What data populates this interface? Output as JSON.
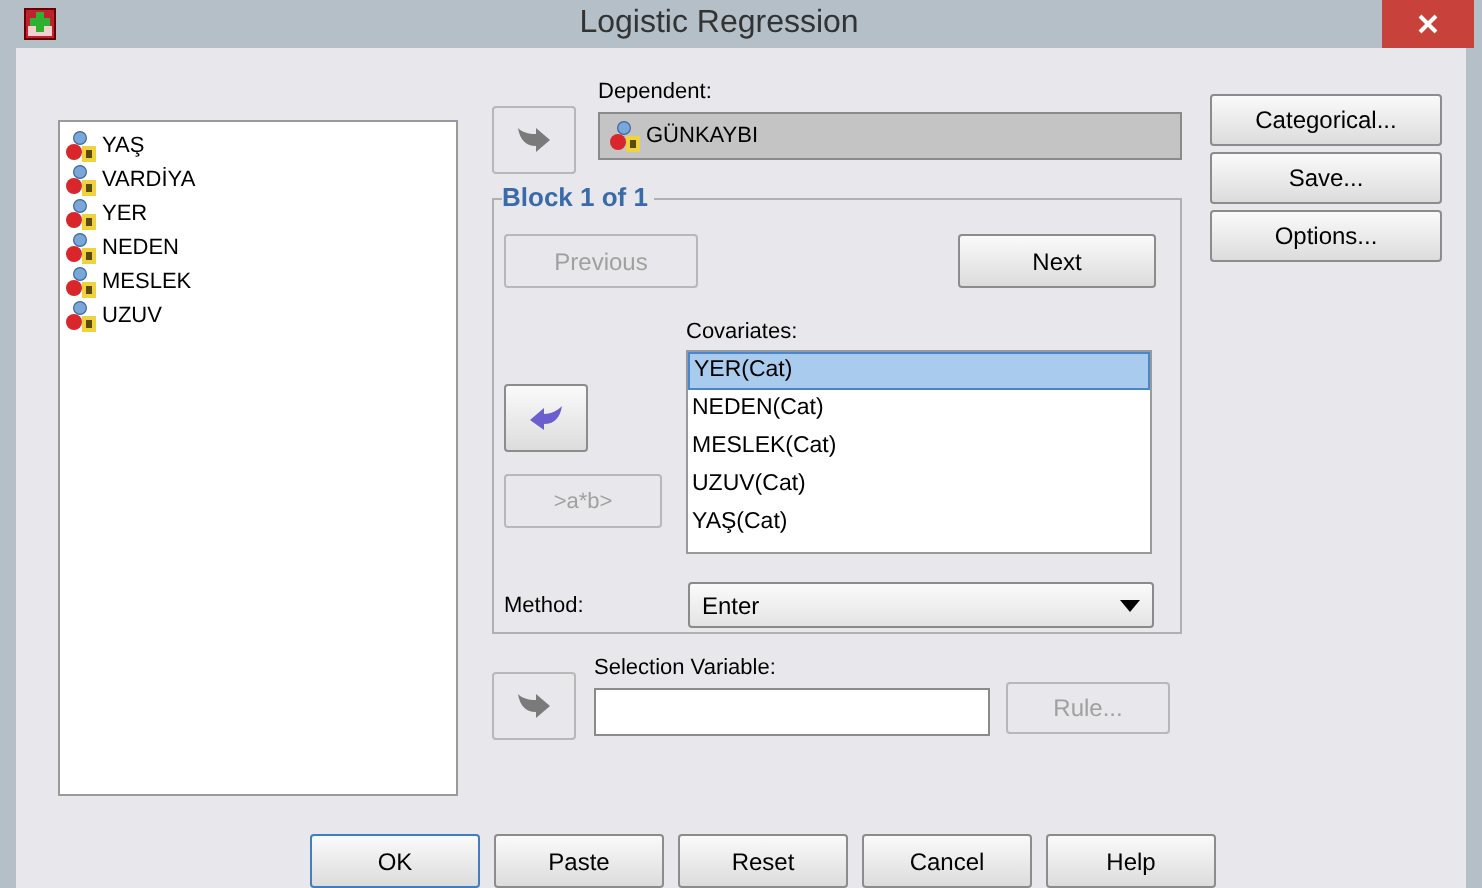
{
  "window": {
    "title": "Logistic Regression"
  },
  "variables": [
    {
      "name": "YAŞ"
    },
    {
      "name": "VARDİYA"
    },
    {
      "name": "YER"
    },
    {
      "name": "NEDEN"
    },
    {
      "name": "MESLEK"
    },
    {
      "name": "UZUV"
    }
  ],
  "dependent": {
    "label": "Dependent:",
    "value": "GÜNKAYBI",
    "move_disabled": true
  },
  "block": {
    "title": "Block 1 of 1",
    "previous": {
      "label": "Previous",
      "disabled": true
    },
    "next": {
      "label": "Next",
      "disabled": false
    },
    "covariates_label": "Covariates:",
    "move_disabled": false,
    "covariates": [
      {
        "name": "YER(Cat)",
        "selected": true
      },
      {
        "name": "NEDEN(Cat)",
        "selected": false
      },
      {
        "name": "MESLEK(Cat)",
        "selected": false
      },
      {
        "name": "UZUV(Cat)",
        "selected": false
      },
      {
        "name": "YAŞ(Cat)",
        "selected": false
      }
    ],
    "interaction": {
      "label": ">a*b>",
      "disabled": true
    },
    "method_label": "Method:",
    "method": "Enter"
  },
  "selection": {
    "label": "Selection Variable:",
    "move_disabled": true,
    "rule": {
      "label": "Rule...",
      "disabled": true
    }
  },
  "side_buttons": [
    "Categorical...",
    "Save...",
    "Options..."
  ],
  "buttons": [
    "OK",
    "Paste",
    "Reset",
    "Cancel",
    "Help"
  ]
}
